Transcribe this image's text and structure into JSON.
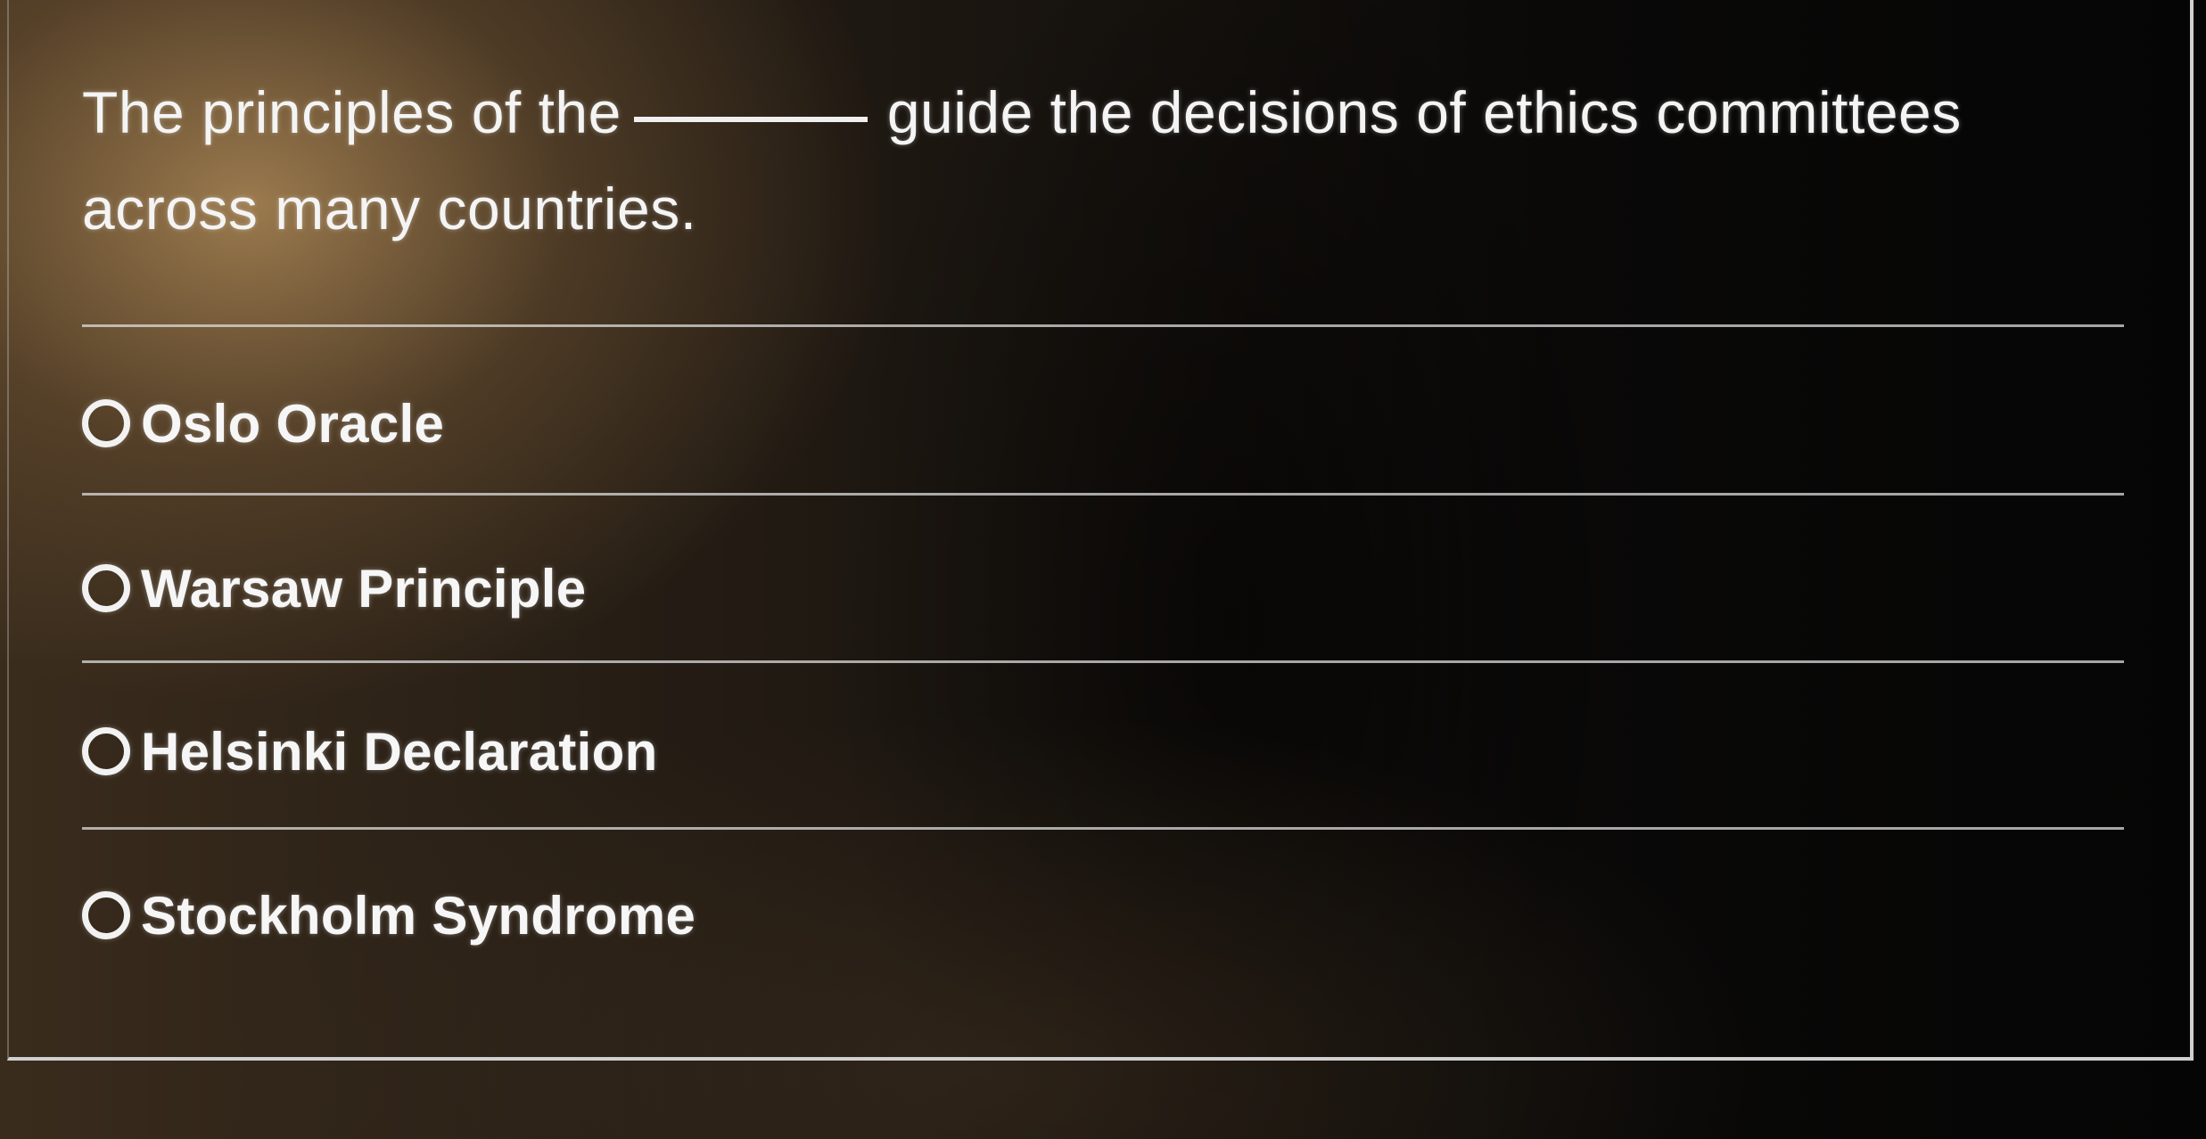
{
  "question": {
    "part_before_blank": "The principles of the",
    "part_after_blank": "guide the decisions of ethics committees across many countries."
  },
  "options": [
    {
      "label": "Oslo Oracle",
      "selected": false
    },
    {
      "label": "Warsaw Principle",
      "selected": false
    },
    {
      "label": "Helsinki Declaration",
      "selected": false
    },
    {
      "label": "Stockholm Syndrome",
      "selected": false
    }
  ]
}
